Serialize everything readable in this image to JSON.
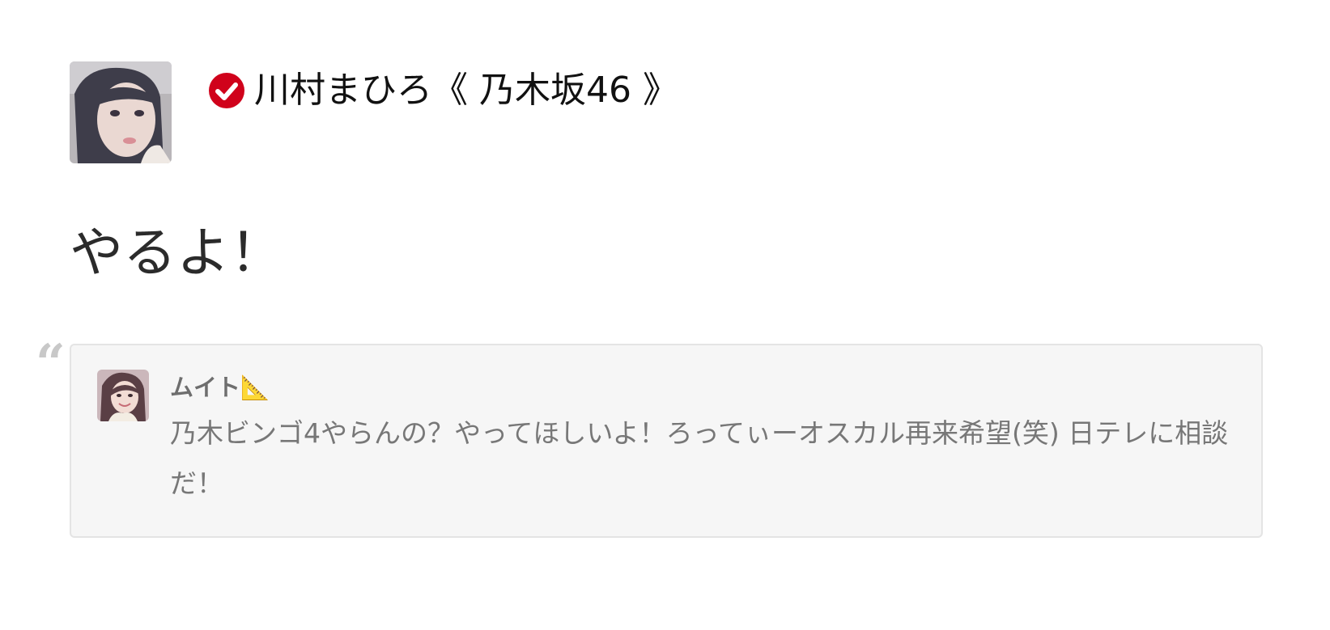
{
  "post": {
    "author_name": "川村まひろ《 乃木坂46 》",
    "verified": true,
    "text": "やるよ！"
  },
  "quoted": {
    "author_name": "ムイト📐",
    "text": "乃木ビンゴ4やらんの？やってほしいよ！ろってぃーオスカル再来希望(笑) 日テレに相談だ！"
  },
  "colors": {
    "verified_badge": "#d0021b",
    "quote_background": "#f6f6f6",
    "quote_border": "#e4e4e4",
    "quote_mark": "#c8c8c8"
  },
  "icons": {
    "verified": "verified-check-icon",
    "quote": "quote-mark-icon"
  }
}
